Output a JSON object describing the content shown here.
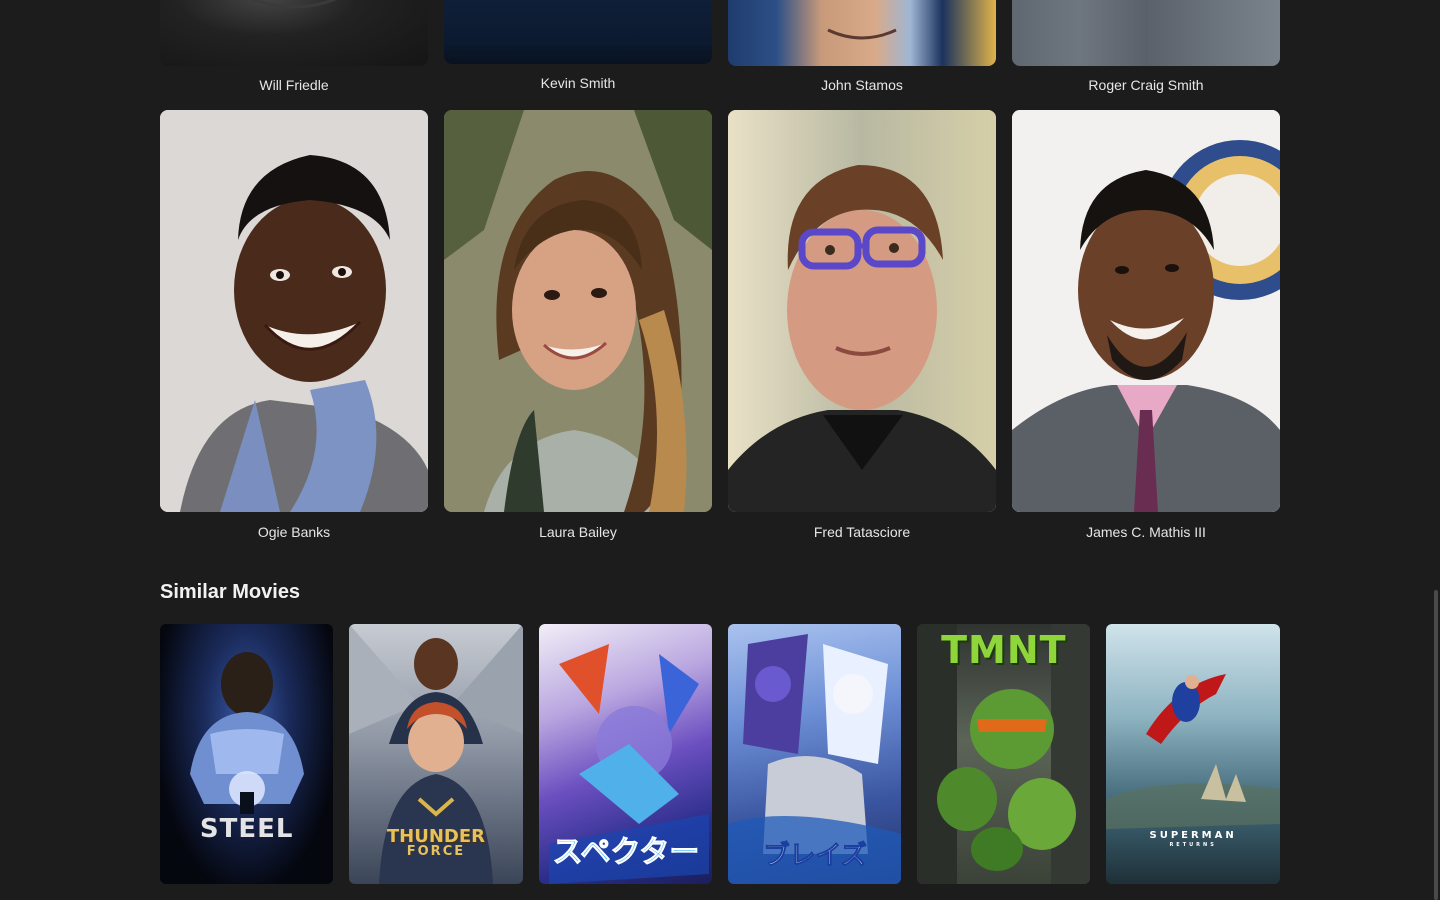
{
  "cast_top": [
    {
      "name": "Will Friedle"
    },
    {
      "name": "Kevin Smith"
    },
    {
      "name": "John Stamos"
    },
    {
      "name": "Roger Craig Smith"
    }
  ],
  "cast_main": [
    {
      "name": "Ogie Banks"
    },
    {
      "name": "Laura Bailey"
    },
    {
      "name": "Fred Tatasciore"
    },
    {
      "name": "James C. Mathis III"
    }
  ],
  "similar": {
    "title": "Similar Movies",
    "movies": [
      {
        "poster_text": "STEEL"
      },
      {
        "poster_text": "THUNDER",
        "poster_subtext": "FORCE"
      },
      {
        "poster_text": ""
      },
      {
        "poster_text": ""
      },
      {
        "poster_text": "TMNT"
      },
      {
        "poster_text": "SUPERMAN",
        "poster_subtext": "RETURNS"
      }
    ]
  }
}
